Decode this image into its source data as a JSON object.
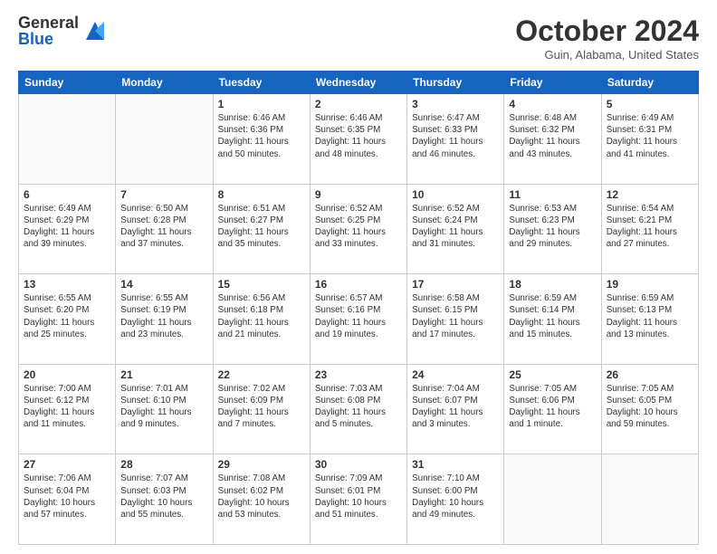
{
  "header": {
    "logo_general": "General",
    "logo_blue": "Blue",
    "month_title": "October 2024",
    "location": "Guin, Alabama, United States"
  },
  "days_of_week": [
    "Sunday",
    "Monday",
    "Tuesday",
    "Wednesday",
    "Thursday",
    "Friday",
    "Saturday"
  ],
  "weeks": [
    [
      {
        "day": "",
        "empty": true
      },
      {
        "day": "",
        "empty": true
      },
      {
        "day": "1",
        "sunrise": "6:46 AM",
        "sunset": "6:36 PM",
        "daylight": "11 hours and 50 minutes."
      },
      {
        "day": "2",
        "sunrise": "6:46 AM",
        "sunset": "6:35 PM",
        "daylight": "11 hours and 48 minutes."
      },
      {
        "day": "3",
        "sunrise": "6:47 AM",
        "sunset": "6:33 PM",
        "daylight": "11 hours and 46 minutes."
      },
      {
        "day": "4",
        "sunrise": "6:48 AM",
        "sunset": "6:32 PM",
        "daylight": "11 hours and 43 minutes."
      },
      {
        "day": "5",
        "sunrise": "6:49 AM",
        "sunset": "6:31 PM",
        "daylight": "11 hours and 41 minutes."
      }
    ],
    [
      {
        "day": "6",
        "sunrise": "6:49 AM",
        "sunset": "6:29 PM",
        "daylight": "11 hours and 39 minutes."
      },
      {
        "day": "7",
        "sunrise": "6:50 AM",
        "sunset": "6:28 PM",
        "daylight": "11 hours and 37 minutes."
      },
      {
        "day": "8",
        "sunrise": "6:51 AM",
        "sunset": "6:27 PM",
        "daylight": "11 hours and 35 minutes."
      },
      {
        "day": "9",
        "sunrise": "6:52 AM",
        "sunset": "6:25 PM",
        "daylight": "11 hours and 33 minutes."
      },
      {
        "day": "10",
        "sunrise": "6:52 AM",
        "sunset": "6:24 PM",
        "daylight": "11 hours and 31 minutes."
      },
      {
        "day": "11",
        "sunrise": "6:53 AM",
        "sunset": "6:23 PM",
        "daylight": "11 hours and 29 minutes."
      },
      {
        "day": "12",
        "sunrise": "6:54 AM",
        "sunset": "6:21 PM",
        "daylight": "11 hours and 27 minutes."
      }
    ],
    [
      {
        "day": "13",
        "sunrise": "6:55 AM",
        "sunset": "6:20 PM",
        "daylight": "11 hours and 25 minutes."
      },
      {
        "day": "14",
        "sunrise": "6:55 AM",
        "sunset": "6:19 PM",
        "daylight": "11 hours and 23 minutes."
      },
      {
        "day": "15",
        "sunrise": "6:56 AM",
        "sunset": "6:18 PM",
        "daylight": "11 hours and 21 minutes."
      },
      {
        "day": "16",
        "sunrise": "6:57 AM",
        "sunset": "6:16 PM",
        "daylight": "11 hours and 19 minutes."
      },
      {
        "day": "17",
        "sunrise": "6:58 AM",
        "sunset": "6:15 PM",
        "daylight": "11 hours and 17 minutes."
      },
      {
        "day": "18",
        "sunrise": "6:59 AM",
        "sunset": "6:14 PM",
        "daylight": "11 hours and 15 minutes."
      },
      {
        "day": "19",
        "sunrise": "6:59 AM",
        "sunset": "6:13 PM",
        "daylight": "11 hours and 13 minutes."
      }
    ],
    [
      {
        "day": "20",
        "sunrise": "7:00 AM",
        "sunset": "6:12 PM",
        "daylight": "11 hours and 11 minutes."
      },
      {
        "day": "21",
        "sunrise": "7:01 AM",
        "sunset": "6:10 PM",
        "daylight": "11 hours and 9 minutes."
      },
      {
        "day": "22",
        "sunrise": "7:02 AM",
        "sunset": "6:09 PM",
        "daylight": "11 hours and 7 minutes."
      },
      {
        "day": "23",
        "sunrise": "7:03 AM",
        "sunset": "6:08 PM",
        "daylight": "11 hours and 5 minutes."
      },
      {
        "day": "24",
        "sunrise": "7:04 AM",
        "sunset": "6:07 PM",
        "daylight": "11 hours and 3 minutes."
      },
      {
        "day": "25",
        "sunrise": "7:05 AM",
        "sunset": "6:06 PM",
        "daylight": "11 hours and 1 minute."
      },
      {
        "day": "26",
        "sunrise": "7:05 AM",
        "sunset": "6:05 PM",
        "daylight": "10 hours and 59 minutes."
      }
    ],
    [
      {
        "day": "27",
        "sunrise": "7:06 AM",
        "sunset": "6:04 PM",
        "daylight": "10 hours and 57 minutes."
      },
      {
        "day": "28",
        "sunrise": "7:07 AM",
        "sunset": "6:03 PM",
        "daylight": "10 hours and 55 minutes."
      },
      {
        "day": "29",
        "sunrise": "7:08 AM",
        "sunset": "6:02 PM",
        "daylight": "10 hours and 53 minutes."
      },
      {
        "day": "30",
        "sunrise": "7:09 AM",
        "sunset": "6:01 PM",
        "daylight": "10 hours and 51 minutes."
      },
      {
        "day": "31",
        "sunrise": "7:10 AM",
        "sunset": "6:00 PM",
        "daylight": "10 hours and 49 minutes."
      },
      {
        "day": "",
        "empty": true
      },
      {
        "day": "",
        "empty": true
      }
    ]
  ],
  "labels": {
    "sunrise_prefix": "Sunrise: ",
    "sunset_prefix": "Sunset: ",
    "daylight_prefix": "Daylight: "
  }
}
